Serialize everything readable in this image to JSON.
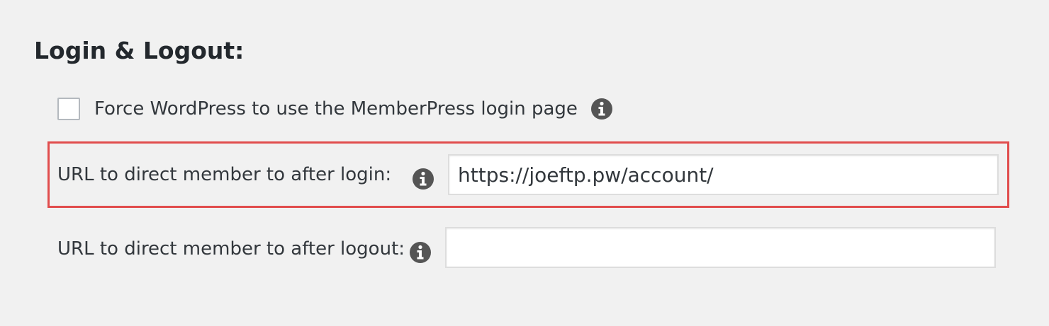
{
  "section": {
    "title": "Login & Logout:"
  },
  "force_login": {
    "label": "Force WordPress to use the MemberPress login page",
    "checked": false,
    "icon": "info-icon"
  },
  "login_redirect": {
    "label": "URL to direct member to after login:",
    "value": "https://joeftp.pw/account/",
    "icon": "info-icon",
    "highlight_color": "#e14d4d"
  },
  "logout_redirect": {
    "label": "URL to direct member to after logout:",
    "value": "",
    "icon": "info-icon"
  },
  "colors": {
    "background": "#f1f1f1",
    "text": "#32373c",
    "icon": "#555555"
  }
}
